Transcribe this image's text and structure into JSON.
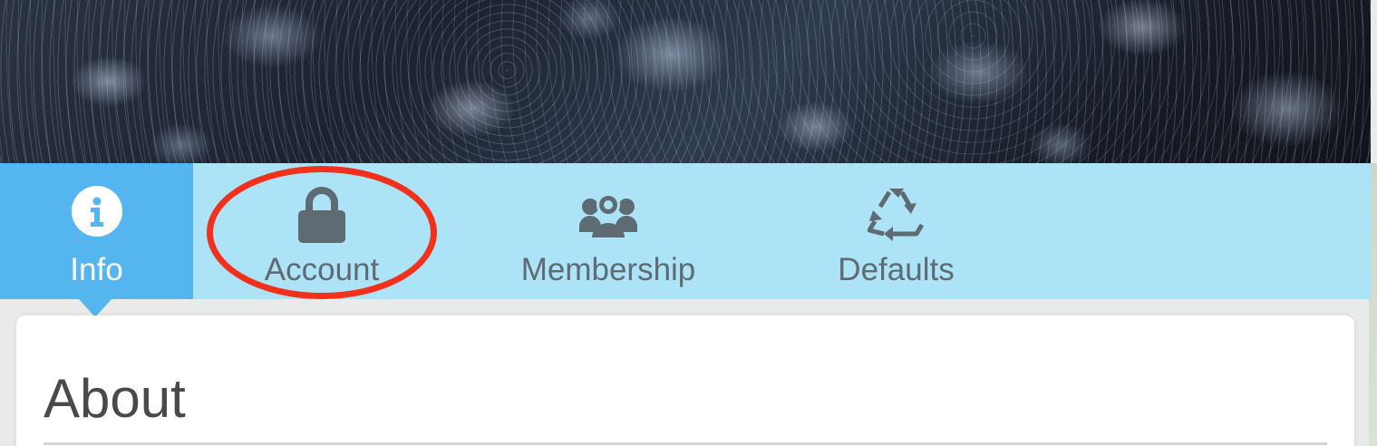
{
  "tabs": [
    {
      "label": "Info",
      "icon": "info-icon",
      "active": true
    },
    {
      "label": "Account",
      "icon": "lock-icon",
      "active": false
    },
    {
      "label": "Membership",
      "icon": "group-icon",
      "active": false
    },
    {
      "label": "Defaults",
      "icon": "recycle-icon",
      "active": false
    }
  ],
  "content": {
    "section_title": "About"
  },
  "colors": {
    "tabbar_bg": "#ade3f6",
    "active_tab_bg": "#55b5ef",
    "tab_text": "#5f6b73",
    "highlight": "#f2311c"
  }
}
